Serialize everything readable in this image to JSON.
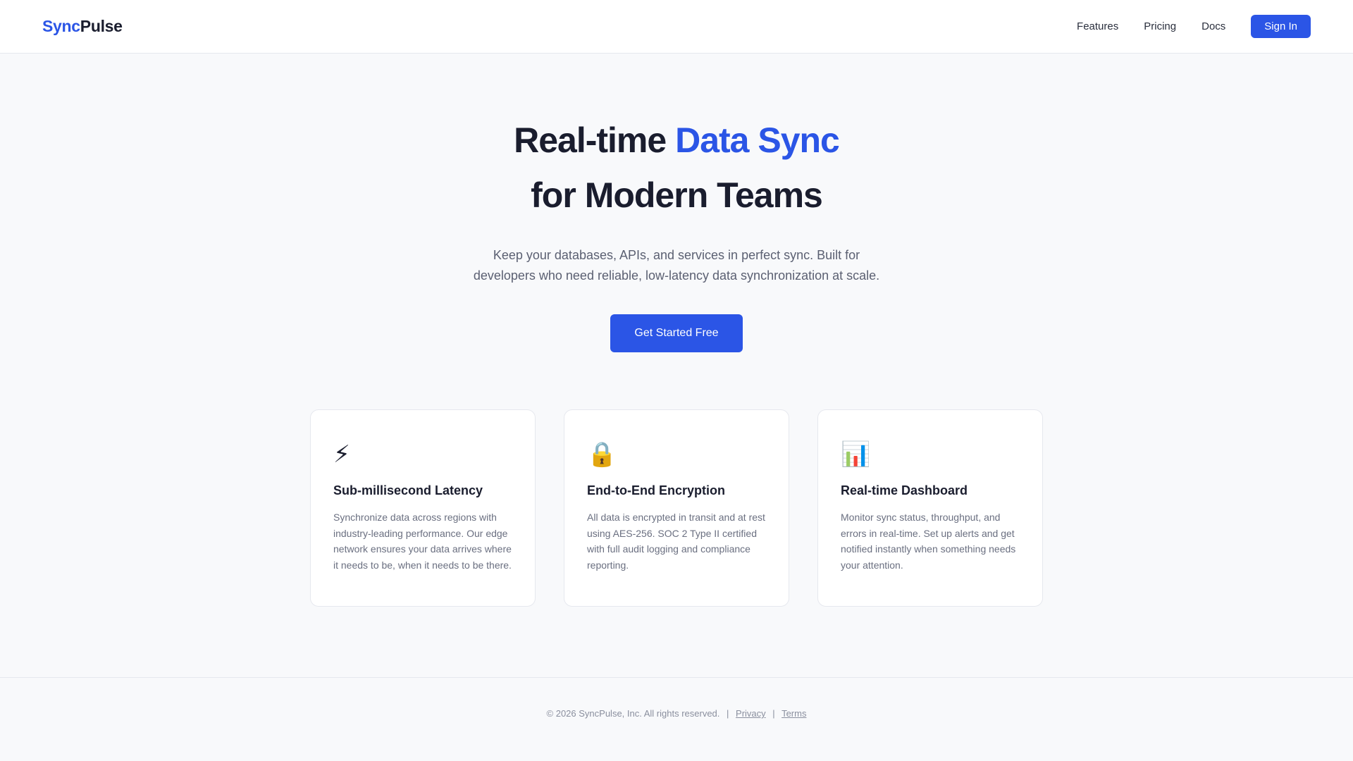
{
  "header": {
    "logo_accent": "Sync",
    "logo_rest": "Pulse",
    "nav": [
      "Features",
      "Pricing",
      "Docs"
    ],
    "signin_label": "Sign In"
  },
  "hero": {
    "title_part1": "Real-time ",
    "title_highlight": "Data Sync",
    "title_line2": "for Modern Teams",
    "subtitle_line1": "Keep your databases, APIs, and services in perfect sync. Built for",
    "subtitle_line2": "developers who need reliable, low-latency data synchronization at scale.",
    "cta_label": "Get Started Free"
  },
  "features": [
    {
      "icon": "⚡",
      "icon_name": "lightning-icon",
      "title": "Sub-millisecond Latency",
      "text": "Synchronize data across regions with industry-leading performance. Our edge network ensures your data arrives where it needs to be, when it needs to be there."
    },
    {
      "icon": "🔒",
      "icon_name": "lock-icon",
      "title": "End-to-End Encryption",
      "text": "All data is encrypted in transit and at rest using AES-256. SOC 2 Type II certified with full audit logging and compliance reporting."
    },
    {
      "icon": "📊",
      "icon_name": "bar-chart-icon",
      "title": "Real-time Dashboard",
      "text": "Monitor sync status, throughput, and errors in real-time. Set up alerts and get notified instantly when something needs your attention."
    }
  ],
  "footer": {
    "copyright": "© 2026 SyncPulse, Inc. All rights reserved.",
    "separator": "|",
    "privacy": "Privacy",
    "terms": "Terms"
  },
  "colors": {
    "accent": "#2b55e6",
    "text_dark": "#1a1d2e",
    "text_muted": "#5b6072",
    "background": "#f8f9fb"
  }
}
